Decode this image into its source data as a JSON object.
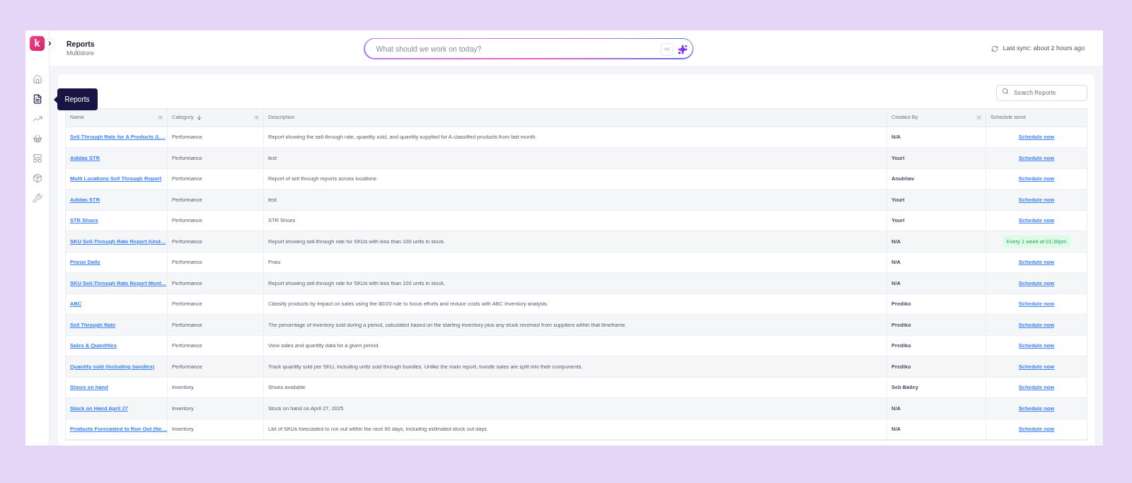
{
  "logo": {
    "letter": "k"
  },
  "sidebar": {
    "tooltip": "Reports",
    "items": [
      {
        "selected": false
      },
      {
        "selected": true
      },
      {
        "selected": false
      },
      {
        "selected": false
      },
      {
        "selected": false
      },
      {
        "selected": false
      },
      {
        "selected": false
      }
    ]
  },
  "header": {
    "title": "Reports",
    "subtitle": "Multistore"
  },
  "ask": {
    "placeholder": "What should we work on today?",
    "shortcut": "⌘K"
  },
  "sync": "Last sync: about 2 hours ago",
  "search": {
    "placeholder": "Search Reports"
  },
  "table": {
    "columns": [
      {
        "label": "Name",
        "filter": true,
        "sorted": false
      },
      {
        "label": "Category",
        "filter": true,
        "sorted": true
      },
      {
        "label": "Description",
        "filter": false,
        "sorted": false
      },
      {
        "label": "Created By",
        "filter": true,
        "sorted": false
      },
      {
        "label": "Schedule send",
        "filter": false,
        "sorted": false
      }
    ],
    "rows": [
      {
        "name": "Sell-Through Rate for A Products (L…",
        "category": "Performance",
        "description": "Report showing the sell-through rate, quantity sold, and quantity supplied for A-classified products from last month.",
        "created_by": "N/A",
        "schedule": {
          "kind": "link",
          "text": "Schedule now"
        }
      },
      {
        "name": "Adidas STR",
        "category": "Performance",
        "description": "test",
        "created_by": "Youri",
        "schedule": {
          "kind": "link",
          "text": "Schedule now"
        }
      },
      {
        "name": "Multi Locations Sell Through Report",
        "category": "Performance",
        "description": "Report of sell through reports across locations",
        "created_by": "Anubhav",
        "schedule": {
          "kind": "link",
          "text": "Schedule now"
        }
      },
      {
        "name": "Adidas STR",
        "category": "Performance",
        "description": "test",
        "created_by": "Youri",
        "schedule": {
          "kind": "link",
          "text": "Schedule now"
        }
      },
      {
        "name": "STR Shoes",
        "category": "Performance",
        "description": "STR Shoes",
        "created_by": "Youri",
        "schedule": {
          "kind": "link",
          "text": "Schedule now"
        }
      },
      {
        "name": "SKU Sell-Through Rate Report (Und…",
        "category": "Performance",
        "description": "Report showing sell-through rate for SKUs with less than 100 units in stock.",
        "created_by": "N/A",
        "schedule": {
          "kind": "badge",
          "text": "Every 1 week at 01:30pm"
        }
      },
      {
        "name": "Pneux Daily",
        "category": "Performance",
        "description": "Pneu",
        "created_by": "N/A",
        "schedule": {
          "kind": "link",
          "text": "Schedule now"
        }
      },
      {
        "name": "SKU Sell-Through Rate Report Mont…",
        "category": "Performance",
        "description": "Report showing sell-through rate for SKUs with less than 100 units in stock.",
        "created_by": "N/A",
        "schedule": {
          "kind": "link",
          "text": "Schedule now"
        }
      },
      {
        "name": "ABC",
        "category": "Performance",
        "description": "Classify products by impact on sales using the 80/20 rule to focus efforts and reduce costs with ABC inventory analysis.",
        "created_by": "Prediko",
        "schedule": {
          "kind": "link",
          "text": "Schedule now"
        }
      },
      {
        "name": "Sell Through Rate",
        "category": "Performance",
        "description": "The percentage of inventory sold during a period, calculated based on the starting inventory plus any stock received from suppliers within that timeframe.",
        "created_by": "Prediko",
        "schedule": {
          "kind": "link",
          "text": "Schedule now"
        }
      },
      {
        "name": "Sales & Quantities",
        "category": "Performance",
        "description": "View sales and quantity data for a given period.",
        "created_by": "Prediko",
        "schedule": {
          "kind": "link",
          "text": "Schedule now"
        }
      },
      {
        "name": "Quantity sold (including bundles)",
        "category": "Performance",
        "description": "Track quantity sold per SKU, including units sold through bundles. Unlike the main report, bundle sales are split into their components.",
        "created_by": "Prediko",
        "schedule": {
          "kind": "link",
          "text": "Schedule now"
        }
      },
      {
        "name": "Shoes on hand",
        "category": "Inventory",
        "description": "Shoes available",
        "created_by": "Seb Bailey",
        "schedule": {
          "kind": "link",
          "text": "Schedule now"
        }
      },
      {
        "name": "Stock on Hand April 27",
        "category": "Inventory",
        "description": "Stock on hand on April 27, 2025",
        "created_by": "N/A",
        "schedule": {
          "kind": "link",
          "text": "Schedule now"
        }
      },
      {
        "name": "Products Forecasted to Run Out (Ne…",
        "category": "Inventory",
        "description": "List of SKUs forecasted to run out within the next 90 days, including estimated stock out days.",
        "created_by": "N/A",
        "schedule": {
          "kind": "link",
          "text": "Schedule now"
        }
      }
    ]
  }
}
